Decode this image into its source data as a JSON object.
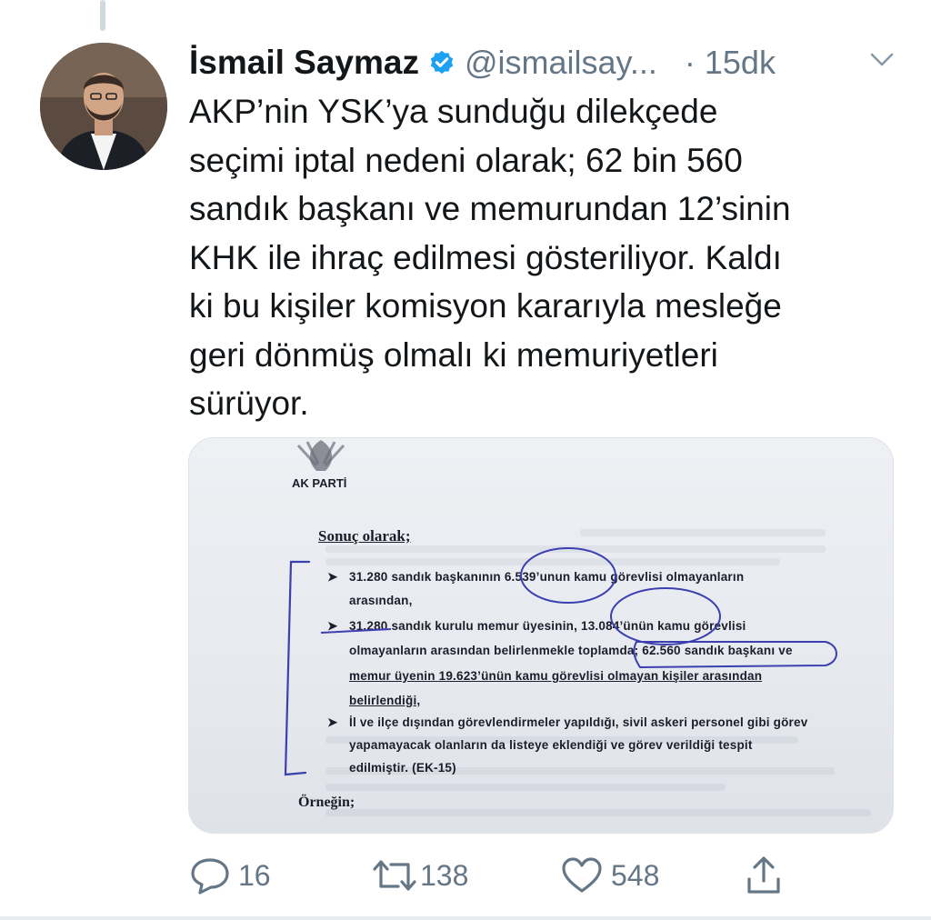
{
  "author": {
    "name": "İsmail Saymaz",
    "handle": "@ismailsay...",
    "time": "· 15dk",
    "verified": true
  },
  "tweet": {
    "text": "AKP’nin YSK’ya sunduğu dilekçede\nseçimi iptal nedeni olarak; 62 bin 560\nsandık başkanı ve memurundan 12’sinin\nKHK ile ihraç edilmesi gösteriliyor. Kaldı\nki bu kişiler komisyon kararıyla mesleğe\ngeri dönmüş olmalı ki memuriyetleri\nsürüyor."
  },
  "document": {
    "logo_text": "AK PARTİ",
    "heading": "Sonuç olarak;",
    "lines": [
      "31.280  sandık  başkanının  6.539’unun  kamu  görevlisi  olmayanların",
      "arasından,",
      "31.280  sandık kurulu memur üyesinin, 13.084’ünün  kamu  görevlisi",
      "olmayanların arasından belirlenmekle toplamda; 62.560 sandık başkanı ve",
      "memur üyenin 19.623’ünün kamu görevlisi olmayan kişiler arasından",
      "belirlendiği,",
      "İl ve ilçe dışından görevlendirmeler yapıldığı, sivil askeri personel gibi görev",
      "yapamayacak  olanların  da  listeye  eklendiği  ve  görev  verildiği  tespit",
      "edilmiştir. (EK-15)"
    ],
    "ornegin": "Örneğin;"
  },
  "actions": {
    "replies": "16",
    "retweets": "138",
    "likes": "548"
  },
  "colors": {
    "text": "#14171a",
    "muted": "#657786",
    "verified": "#1da1f2",
    "pen": "#3b3fb0"
  },
  "icons": [
    "verified-badge-icon",
    "chevron-down-icon",
    "reply-icon",
    "retweet-icon",
    "like-icon",
    "share-icon"
  ]
}
